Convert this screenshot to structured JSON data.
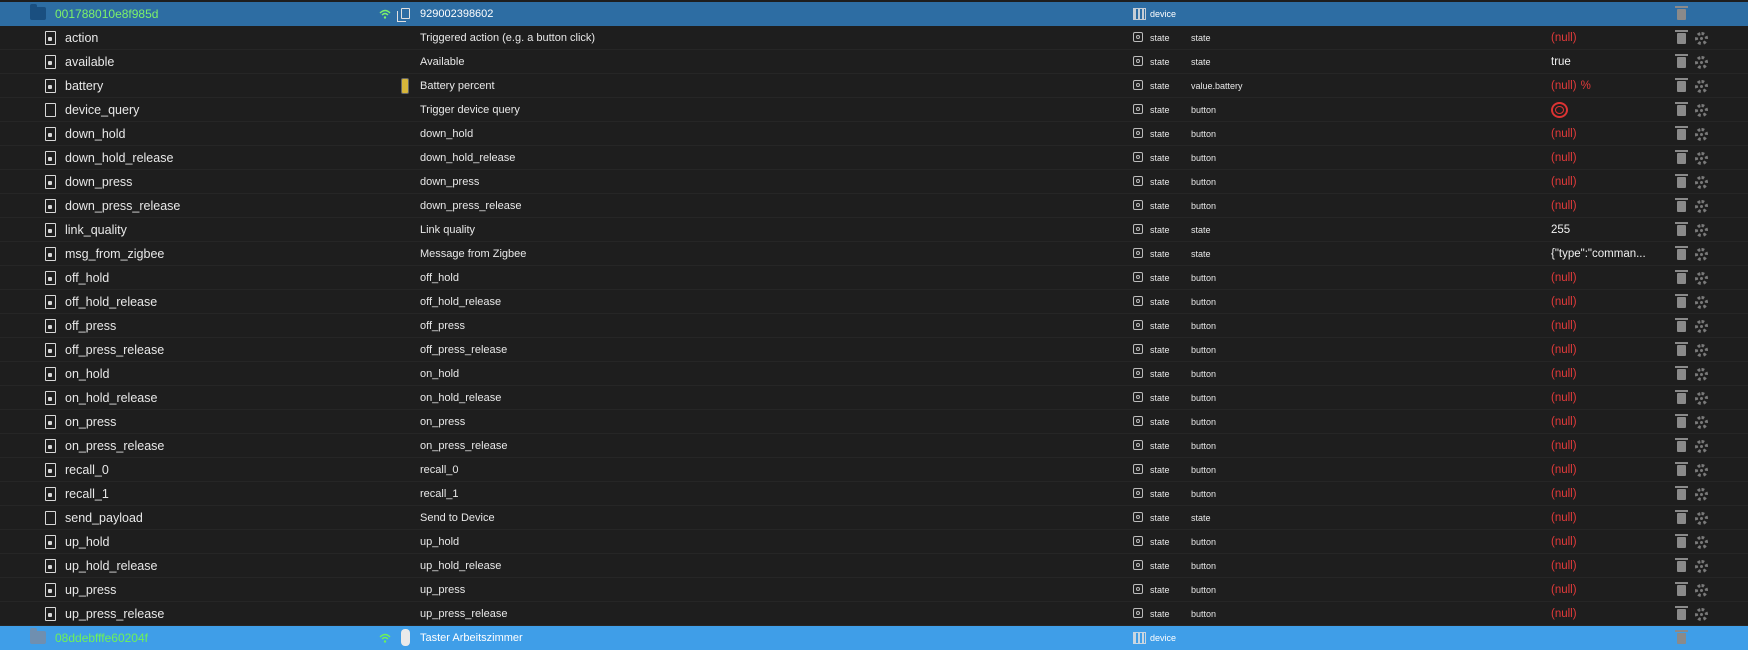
{
  "device": {
    "id": "001788010e8f985d",
    "name": "929002398602",
    "type": "device"
  },
  "states": [
    {
      "name": "action",
      "desc": "Triggered action (e.g. a button click)",
      "type": "state",
      "role": "state",
      "value": "(null)",
      "locked": true
    },
    {
      "name": "available",
      "desc": "Available",
      "type": "state",
      "role": "state",
      "value": "true",
      "locked": true
    },
    {
      "name": "battery",
      "desc": "Battery percent",
      "type": "state",
      "role": "value.battery",
      "value": "(null)",
      "unit": "%",
      "locked": true
    },
    {
      "name": "device_query",
      "desc": "Trigger device query",
      "type": "state",
      "role": "button",
      "value": "",
      "locked": false
    },
    {
      "name": "down_hold",
      "desc": "down_hold",
      "type": "state",
      "role": "button",
      "value": "(null)",
      "locked": true
    },
    {
      "name": "down_hold_release",
      "desc": "down_hold_release",
      "type": "state",
      "role": "button",
      "value": "(null)",
      "locked": true
    },
    {
      "name": "down_press",
      "desc": "down_press",
      "type": "state",
      "role": "button",
      "value": "(null)",
      "locked": true
    },
    {
      "name": "down_press_release",
      "desc": "down_press_release",
      "type": "state",
      "role": "button",
      "value": "(null)",
      "locked": true
    },
    {
      "name": "link_quality",
      "desc": "Link quality",
      "type": "state",
      "role": "state",
      "value": "255",
      "locked": true
    },
    {
      "name": "msg_from_zigbee",
      "desc": "Message from Zigbee",
      "type": "state",
      "role": "state",
      "value": "{\"type\":\"comman...",
      "locked": true
    },
    {
      "name": "off_hold",
      "desc": "off_hold",
      "type": "state",
      "role": "button",
      "value": "(null)",
      "locked": true
    },
    {
      "name": "off_hold_release",
      "desc": "off_hold_release",
      "type": "state",
      "role": "button",
      "value": "(null)",
      "locked": true
    },
    {
      "name": "off_press",
      "desc": "off_press",
      "type": "state",
      "role": "button",
      "value": "(null)",
      "locked": true
    },
    {
      "name": "off_press_release",
      "desc": "off_press_release",
      "type": "state",
      "role": "button",
      "value": "(null)",
      "locked": true
    },
    {
      "name": "on_hold",
      "desc": "on_hold",
      "type": "state",
      "role": "button",
      "value": "(null)",
      "locked": true
    },
    {
      "name": "on_hold_release",
      "desc": "on_hold_release",
      "type": "state",
      "role": "button",
      "value": "(null)",
      "locked": true
    },
    {
      "name": "on_press",
      "desc": "on_press",
      "type": "state",
      "role": "button",
      "value": "(null)",
      "locked": true
    },
    {
      "name": "on_press_release",
      "desc": "on_press_release",
      "type": "state",
      "role": "button",
      "value": "(null)",
      "locked": true
    },
    {
      "name": "recall_0",
      "desc": "recall_0",
      "type": "state",
      "role": "button",
      "value": "(null)",
      "locked": true
    },
    {
      "name": "recall_1",
      "desc": "recall_1",
      "type": "state",
      "role": "button",
      "value": "(null)",
      "locked": true
    },
    {
      "name": "send_payload",
      "desc": "Send to Device",
      "type": "state",
      "role": "state",
      "value": "(null)",
      "locked": false
    },
    {
      "name": "up_hold",
      "desc": "up_hold",
      "type": "state",
      "role": "button",
      "value": "(null)",
      "locked": true
    },
    {
      "name": "up_hold_release",
      "desc": "up_hold_release",
      "type": "state",
      "role": "button",
      "value": "(null)",
      "locked": true
    },
    {
      "name": "up_press",
      "desc": "up_press",
      "type": "state",
      "role": "button",
      "value": "(null)",
      "locked": true
    },
    {
      "name": "up_press_release",
      "desc": "up_press_release",
      "type": "state",
      "role": "button",
      "value": "(null)",
      "locked": true
    }
  ],
  "device2": {
    "id": "08ddebfffe60204f",
    "name": "Taster Arbeitszimmer",
    "type": "device"
  },
  "colors": {
    "null_value": "#e23a3a",
    "device_row": "#2d6da3",
    "selected_device_row": "#3f9ee8",
    "device_id": "#7df26a"
  }
}
